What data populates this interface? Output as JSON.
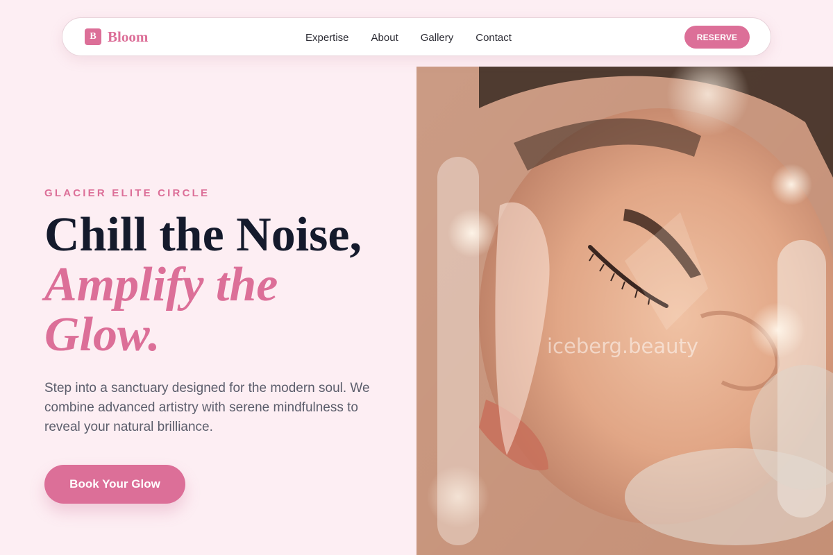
{
  "brand": {
    "logo_letter": "B",
    "name": "Bloom",
    "accent_color": "#dc6f98"
  },
  "nav": {
    "links": [
      "Expertise",
      "About",
      "Gallery",
      "Contact"
    ],
    "reserve_label": "RESERVE"
  },
  "hero": {
    "eyebrow": "GLACIER ELITE CIRCLE",
    "headline_line1": "Chill the Noise,",
    "headline_line2": "Amplify the Glow.",
    "subtext": "Step into a sanctuary designed for the modern soul. We combine advanced artistry with serene mindfulness to reveal your natural brilliance.",
    "cta_label": "Book Your Glow"
  },
  "image": {
    "subject": "woman-face-glow-photo",
    "watermark": "iceberg.beauty"
  },
  "colors": {
    "background": "#fdeef3",
    "heading": "#141a2c",
    "body_text": "#5b5d6b",
    "accent": "#dc6f98"
  }
}
